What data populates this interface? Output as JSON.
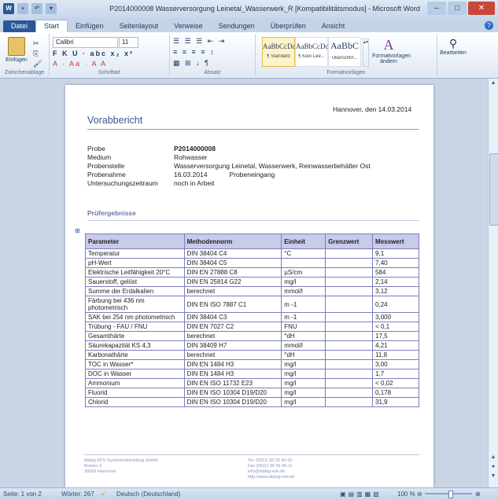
{
  "window": {
    "title": "P2014000008 Wasserversorgung Leinetal_Wasserwerk_R [Kompatibilitätsmodus] - Microsoft Word",
    "controls": {
      "minimize": "–",
      "maximize": "□",
      "close": "✕"
    }
  },
  "quick_access": {
    "word_icon": "W",
    "save": "▪",
    "undo": "↶",
    "redo": "▾"
  },
  "ribbon_tabs": [
    "Datei",
    "Start",
    "Einfügen",
    "Seitenlayout",
    "Verweise",
    "Sendungen",
    "Überprüfen",
    "Ansicht"
  ],
  "ribbon": {
    "clipboard": {
      "paste_label": "Einfügen",
      "group": "Zwischenablage"
    },
    "font": {
      "name": "Calibri",
      "size": "11",
      "group": "Schriftart",
      "row1": "F K U · abc x₂ x²",
      "row2": "A · Aa · A A"
    },
    "paragraph": {
      "group": "Absatz",
      "row1": "☰ ☰ ☰ ⇤ ⇥",
      "row2": "≡ ≡ ≡ ≡ ↕",
      "row3": "▦ ⊞ ↓ ¶"
    },
    "styles": {
      "group": "Formatvorlagen",
      "items": [
        {
          "sample": "AaBbCcDc",
          "name": "¶ Standard"
        },
        {
          "sample": "AaBbCcDc",
          "name": "¶ Kein Lee..."
        },
        {
          "sample": "AaBbC",
          "name": "Überschrif..."
        }
      ],
      "change_label": "Formatvorlagen ändern",
      "edit_label": "Bearbeiten"
    }
  },
  "document": {
    "date_line": "Hannover, den 14.03.2014",
    "heading": "Vorabbericht",
    "info": [
      {
        "key": "Probe",
        "value": "P2014000008",
        "bold": true
      },
      {
        "key": "Medium",
        "value": "Rohwasser"
      },
      {
        "key": "Probenstelle",
        "value": "Wasserversorgung Leinetal, Wasserwerk, Reinwasserbehälter Ost"
      },
      {
        "key": "Probenahme",
        "value": "16.03.2014",
        "extra": "Probeneingang"
      },
      {
        "key": "Untersuchungszeitraum",
        "value": "noch in Arbeit"
      }
    ],
    "subheading": "Prüfergebnisse",
    "table": {
      "headers": [
        "Parameter",
        "Methodennorm",
        "Einheit",
        "Grenzwert",
        "Messwert"
      ],
      "rows": [
        [
          "Temperatur",
          "DIN 38404 C4",
          "°C",
          "",
          "9,1"
        ],
        [
          "pH-Wert",
          "DIN 38404 C5",
          "",
          "",
          "7,40"
        ],
        [
          "Elektrische Leitfähigkeit 20°C",
          "DIN EN 27888 C8",
          "µS/cm",
          "",
          "584"
        ],
        [
          "Sauerstoff, gelöst",
          "DIN EN 25814 G22",
          "mg/l",
          "",
          "2,14"
        ],
        [
          "Summe der Erdalkalien",
          "berechnet",
          "mmol/l",
          "",
          "3,12"
        ],
        [
          "Färbung bei 436 nm photometrisch",
          "DIN EN ISO 7887 C1",
          "m -1",
          "",
          "0,24"
        ],
        [
          "SAK bei 254 nm photometrisch",
          "DIN 38404 C3",
          "m -1",
          "",
          "3,000"
        ],
        [
          "Trübung - FAU / FNU",
          "DIN EN 7027 C2",
          "FNU",
          "",
          "< 0,1"
        ],
        [
          "Gesamthärte",
          "berechnet",
          "°dH",
          "",
          "17,5"
        ],
        [
          "Säurekapazität KS 4,3",
          "DIN 38409 H7",
          "mmol/l",
          "",
          "4,21"
        ],
        [
          "Karbonathärte",
          "berechnet",
          "°dH",
          "",
          "11,8"
        ],
        [
          "TOC in Wasser*",
          "DIN EN 1484 H3",
          "mg/l",
          "",
          "3,00"
        ],
        [
          "DOC in Wasser",
          "DIN EN 1484 H3",
          "mg/l",
          "",
          "1,7"
        ],
        [
          "Ammonium",
          "DIN EN ISO 11732 E23",
          "mg/l",
          "",
          "< 0,02"
        ],
        [
          "Fluorid",
          "DIN EN ISO 10304 D19/D20",
          "mg/l",
          "",
          "0,178"
        ],
        [
          "Chlorid",
          "DIN EN ISO 10304 D19/D20",
          "mg/l",
          "",
          "31,9"
        ]
      ]
    },
    "footer_left": [
      "dialog EDV Systementwicklung GmbH",
      "Bumen 3",
      "30659 Hannover"
    ],
    "footer_right": [
      "Tel. (0511) 93 33 40-10",
      "Fax (0511) 90 59 40-11",
      "info@dialog-edv.de",
      "http://www.dialog-edv.de"
    ]
  },
  "status": {
    "page": "Seite: 1 von 2",
    "words": "Wörter: 267",
    "language": "Deutsch (Deutschland)",
    "zoom": "100 %"
  }
}
